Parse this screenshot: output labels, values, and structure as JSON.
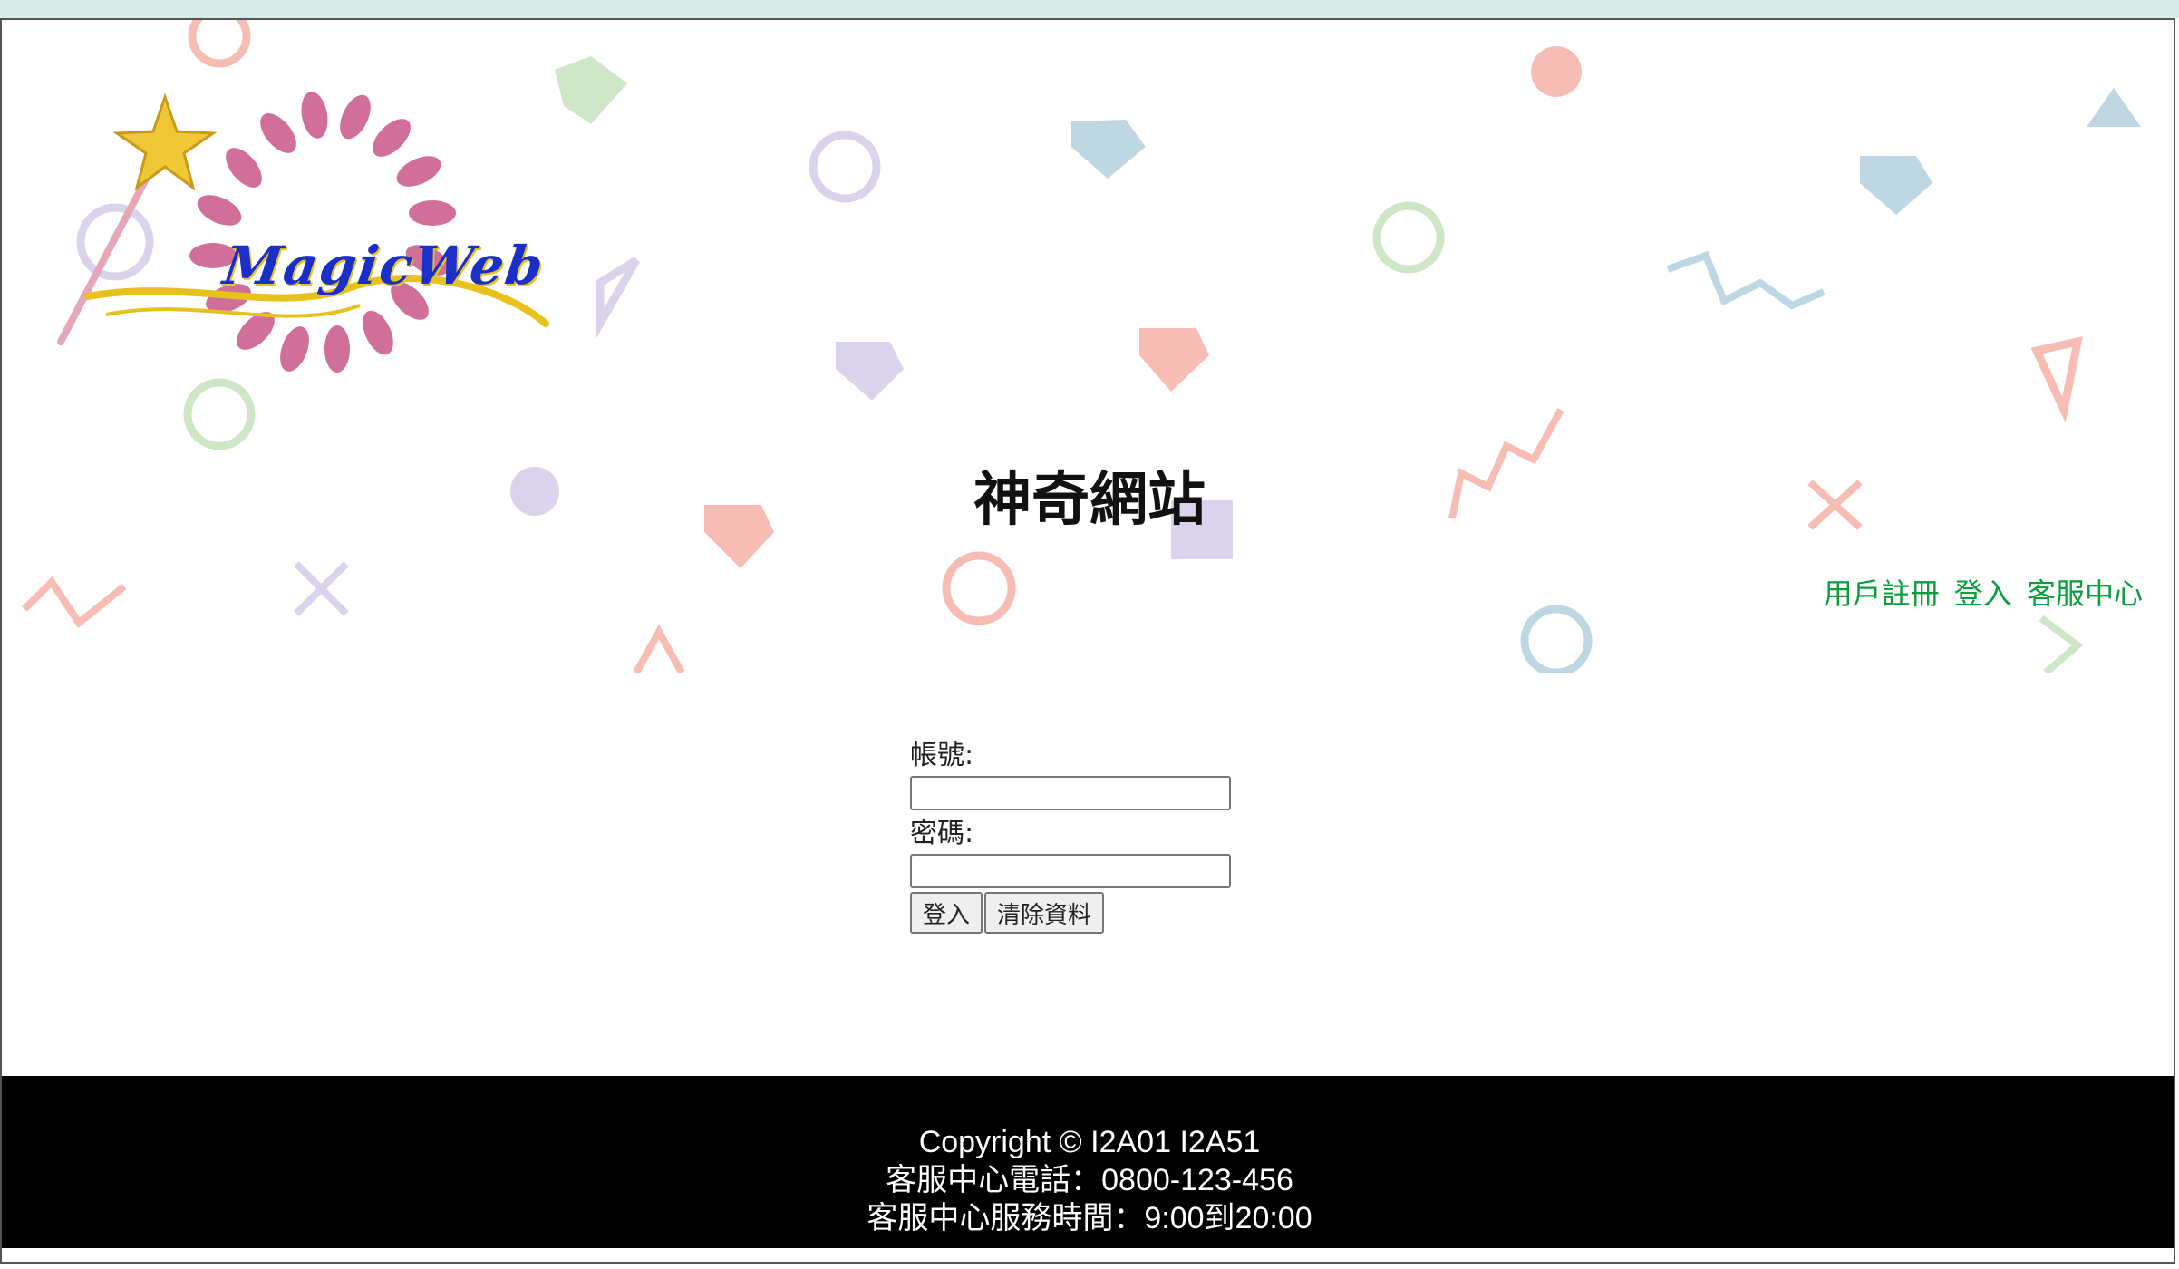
{
  "logo": {
    "text": "MagicWeb"
  },
  "header": {
    "site_title": "神奇網站"
  },
  "nav": {
    "items": [
      {
        "label": "用戶註冊"
      },
      {
        "label": "登入"
      },
      {
        "label": "客服中心"
      }
    ]
  },
  "login_form": {
    "account_label": "帳號:",
    "password_label": "密碼:",
    "account_value": "",
    "password_value": "",
    "submit_label": "登入",
    "reset_label": "清除資料"
  },
  "footer": {
    "copyright": "Copyright © I2A01 I2A51",
    "phone": "客服中心電話：0800-123-456",
    "hours": "客服中心服務時間：9:00到20:00"
  },
  "colors": {
    "nav_link": "#0b9d3c",
    "footer_bg": "#000000",
    "topstrip": "#d9ecea"
  }
}
